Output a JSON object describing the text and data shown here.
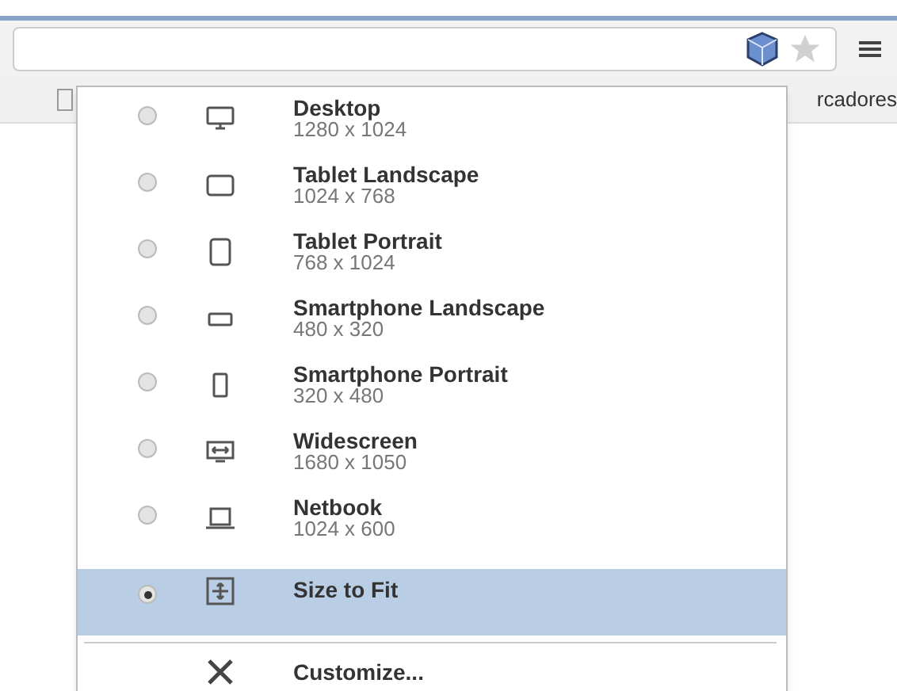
{
  "bookmarks_bar": {
    "partial_label": "rcadores"
  },
  "presets": [
    {
      "kind": "desktop",
      "name": "Desktop",
      "size": "1280 x 1024",
      "selected": false
    },
    {
      "kind": "tablet-landscape",
      "name": "Tablet Landscape",
      "size": "1024 x 768",
      "selected": false
    },
    {
      "kind": "tablet-portrait",
      "name": "Tablet Portrait",
      "size": "768 x 1024",
      "selected": false
    },
    {
      "kind": "phone-landscape",
      "name": "Smartphone Landscape",
      "size": "480 x 320",
      "selected": false
    },
    {
      "kind": "phone-portrait",
      "name": "Smartphone Portrait",
      "size": "320 x 480",
      "selected": false
    },
    {
      "kind": "widescreen",
      "name": "Widescreen",
      "size": "1680 x 1050",
      "selected": false
    },
    {
      "kind": "netbook",
      "name": "Netbook",
      "size": "1024 x 600",
      "selected": false
    },
    {
      "kind": "fit",
      "name": "Size to Fit",
      "selected": true
    }
  ],
  "customize": {
    "label": "Customize..."
  }
}
